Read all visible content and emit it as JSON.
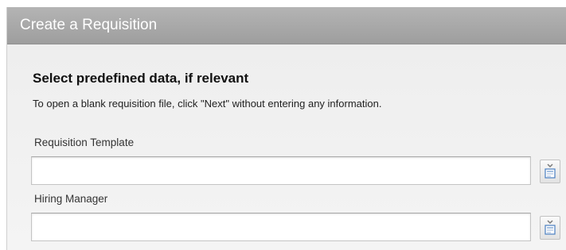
{
  "window": {
    "title": "Create a Requisition"
  },
  "section": {
    "title": "Select predefined data, if relevant",
    "instructions": "To open a blank requisition file, click \"Next\" without entering any information."
  },
  "fields": {
    "template": {
      "label": "Requisition Template",
      "value": "",
      "picker_icon": "selector-list-icon"
    },
    "manager": {
      "label": "Hiring Manager",
      "value": "",
      "picker_icon": "selector-list-icon"
    }
  },
  "colors": {
    "header_bg": "#a9a9a9",
    "panel_bg": "#f1f1f1",
    "icon_accent": "#4a7fc1"
  }
}
